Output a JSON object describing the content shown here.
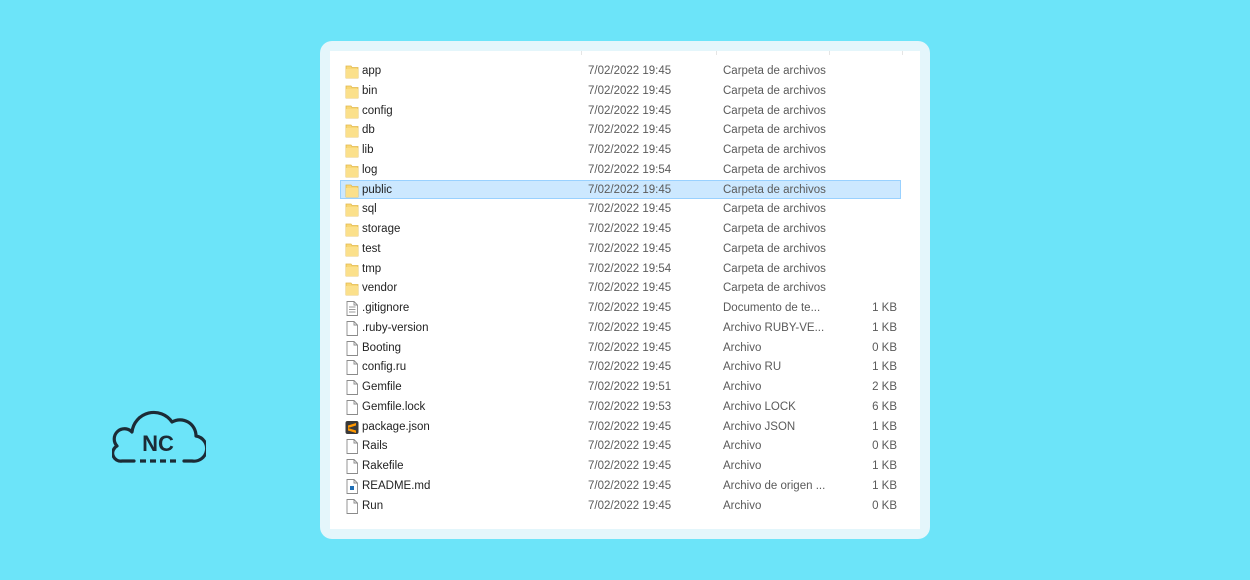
{
  "logo": {
    "text": "NC",
    "icon": "cloud-icon"
  },
  "files": [
    {
      "name": "app",
      "date": "7/02/2022 19:45",
      "type": "Carpeta de archivos",
      "size": "",
      "icon": "folder-icon"
    },
    {
      "name": "bin",
      "date": "7/02/2022 19:45",
      "type": "Carpeta de archivos",
      "size": "",
      "icon": "folder-icon"
    },
    {
      "name": "config",
      "date": "7/02/2022 19:45",
      "type": "Carpeta de archivos",
      "size": "",
      "icon": "folder-icon"
    },
    {
      "name": "db",
      "date": "7/02/2022 19:45",
      "type": "Carpeta de archivos",
      "size": "",
      "icon": "folder-icon"
    },
    {
      "name": "lib",
      "date": "7/02/2022 19:45",
      "type": "Carpeta de archivos",
      "size": "",
      "icon": "folder-icon"
    },
    {
      "name": "log",
      "date": "7/02/2022 19:54",
      "type": "Carpeta de archivos",
      "size": "",
      "icon": "folder-icon"
    },
    {
      "name": "public",
      "date": "7/02/2022 19:45",
      "type": "Carpeta de archivos",
      "size": "",
      "icon": "folder-icon",
      "selected": true
    },
    {
      "name": "sql",
      "date": "7/02/2022 19:45",
      "type": "Carpeta de archivos",
      "size": "",
      "icon": "folder-icon"
    },
    {
      "name": "storage",
      "date": "7/02/2022 19:45",
      "type": "Carpeta de archivos",
      "size": "",
      "icon": "folder-icon"
    },
    {
      "name": "test",
      "date": "7/02/2022 19:45",
      "type": "Carpeta de archivos",
      "size": "",
      "icon": "folder-icon"
    },
    {
      "name": "tmp",
      "date": "7/02/2022 19:54",
      "type": "Carpeta de archivos",
      "size": "",
      "icon": "folder-icon"
    },
    {
      "name": "vendor",
      "date": "7/02/2022 19:45",
      "type": "Carpeta de archivos",
      "size": "",
      "icon": "folder-icon"
    },
    {
      "name": ".gitignore",
      "date": "7/02/2022 19:45",
      "type": "Documento de te...",
      "size": "1 KB",
      "icon": "text-document-icon"
    },
    {
      "name": ".ruby-version",
      "date": "7/02/2022 19:45",
      "type": "Archivo RUBY-VE...",
      "size": "1 KB",
      "icon": "file-icon"
    },
    {
      "name": "Booting",
      "date": "7/02/2022 19:45",
      "type": "Archivo",
      "size": "0 KB",
      "icon": "file-icon"
    },
    {
      "name": "config.ru",
      "date": "7/02/2022 19:45",
      "type": "Archivo RU",
      "size": "1 KB",
      "icon": "file-icon"
    },
    {
      "name": "Gemfile",
      "date": "7/02/2022 19:51",
      "type": "Archivo",
      "size": "2 KB",
      "icon": "file-icon"
    },
    {
      "name": "Gemfile.lock",
      "date": "7/02/2022 19:53",
      "type": "Archivo LOCK",
      "size": "6 KB",
      "icon": "file-icon"
    },
    {
      "name": "package.json",
      "date": "7/02/2022 19:45",
      "type": "Archivo JSON",
      "size": "1 KB",
      "icon": "sublime-text-icon"
    },
    {
      "name": "Rails",
      "date": "7/02/2022 19:45",
      "type": "Archivo",
      "size": "0 KB",
      "icon": "file-icon"
    },
    {
      "name": "Rakefile",
      "date": "7/02/2022 19:45",
      "type": "Archivo",
      "size": "1 KB",
      "icon": "file-icon"
    },
    {
      "name": "README.md",
      "date": "7/02/2022 19:45",
      "type": "Archivo de origen ...",
      "size": "1 KB",
      "icon": "markdown-file-icon"
    },
    {
      "name": "Run",
      "date": "7/02/2022 19:45",
      "type": "Archivo",
      "size": "0 KB",
      "icon": "file-icon"
    }
  ],
  "colors": {
    "background": "#6ce4f9",
    "selection": "#cce8ff",
    "selection_border": "#99d1ff",
    "folder": "#f8d775",
    "logo_stroke": "#1c2b36"
  }
}
